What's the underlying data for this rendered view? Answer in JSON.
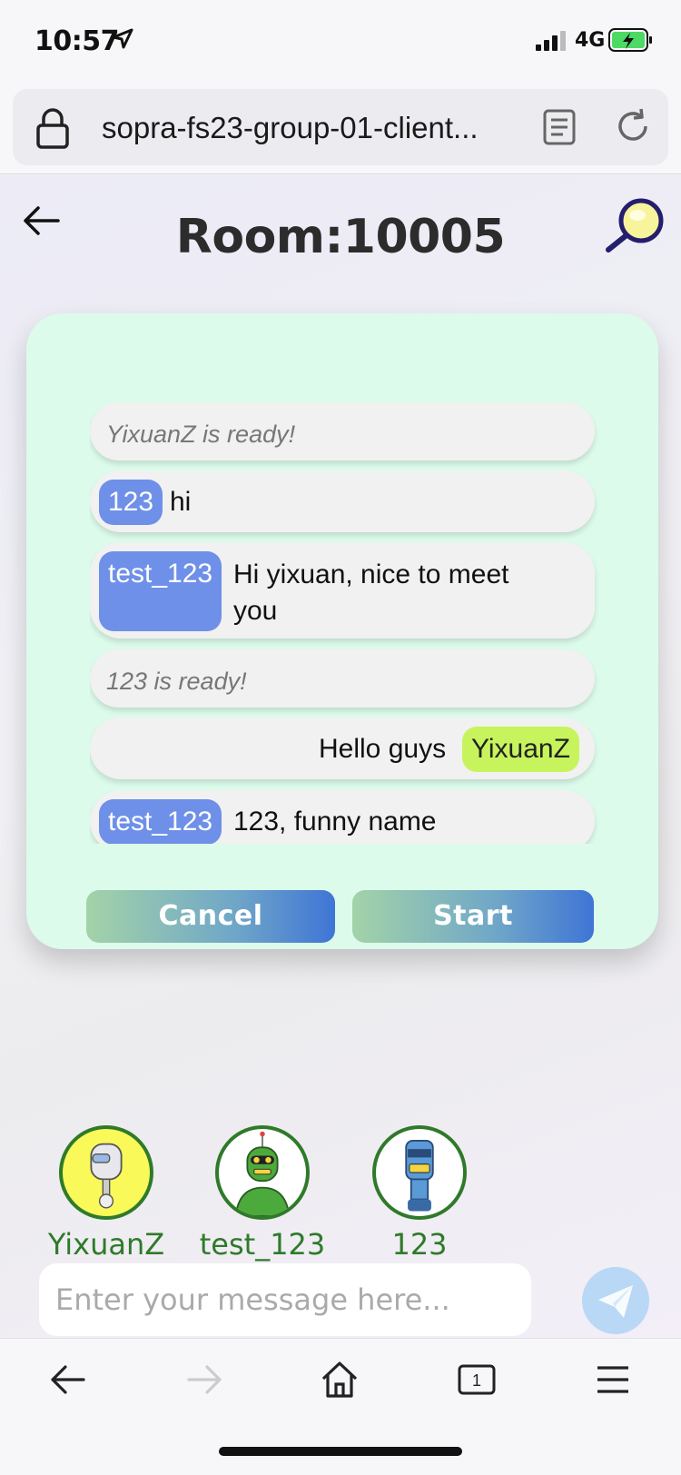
{
  "status_bar": {
    "time": "10:57",
    "network": "4G"
  },
  "browser": {
    "url": "sopra-fs23-group-01-client..."
  },
  "header": {
    "title": "Room:10005"
  },
  "chat": {
    "messages": [
      {
        "type": "system",
        "text": "YixuanZ is ready!"
      },
      {
        "type": "other",
        "sender": "123",
        "text": "hi"
      },
      {
        "type": "other",
        "sender": "test_123",
        "text": "Hi yixuan, nice to meet you"
      },
      {
        "type": "system",
        "text": "123 is ready!"
      },
      {
        "type": "self",
        "sender": "YixuanZ",
        "text": "Hello guys"
      },
      {
        "type": "other",
        "sender": "test_123",
        "text": "123, funny name"
      }
    ]
  },
  "buttons": {
    "cancel": "Cancel",
    "start": "Start"
  },
  "players": [
    {
      "name": "YixuanZ"
    },
    {
      "name": "test_123"
    },
    {
      "name": "123"
    }
  ],
  "composer": {
    "placeholder": "Enter your message here..."
  },
  "toolbar": {
    "tabs_count": "1"
  },
  "colors": {
    "accent_green": "#2f7a2a",
    "self_tag": "#c7f45c",
    "other_tag": "#6f90e8",
    "card_bg": "#dcfbeb"
  }
}
